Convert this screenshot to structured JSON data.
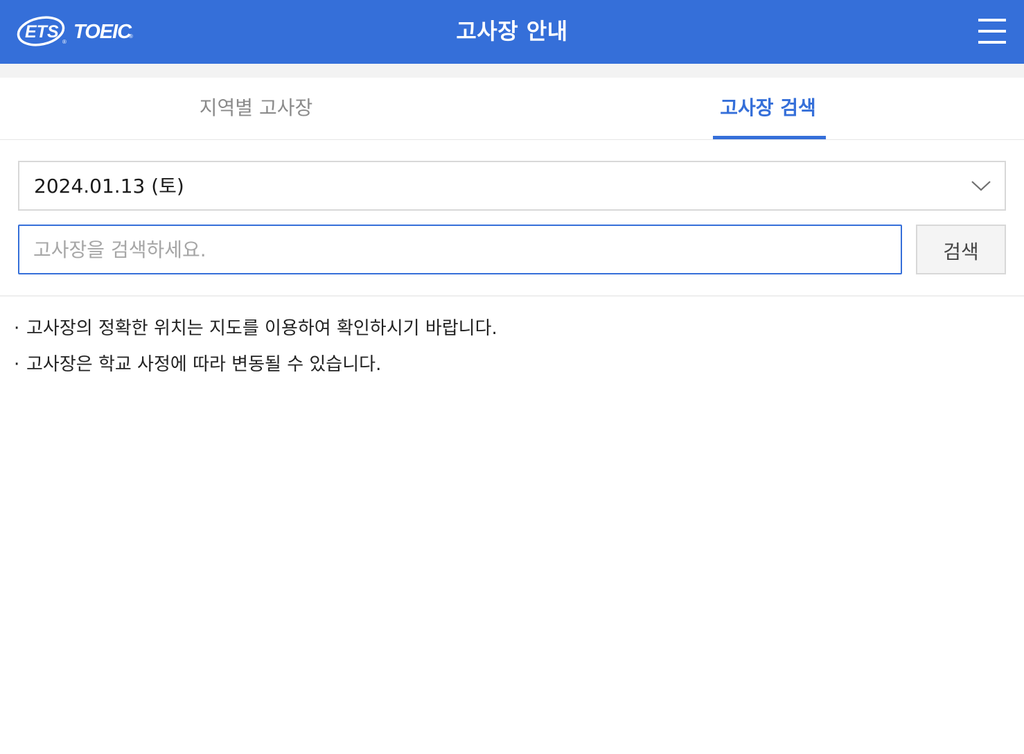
{
  "header": {
    "logo_text": "ETS TOEIC",
    "title": "고사장 안내",
    "menu_icon": "hamburger-menu-icon",
    "background_color": "#356fd9"
  },
  "tabs": [
    {
      "label": "지역별 고사장",
      "active": false
    },
    {
      "label": "고사장 검색",
      "active": true
    }
  ],
  "search": {
    "date_selected": "2024.01.13 (토)",
    "dropdown_icon": "chevron-down-icon",
    "placeholder": "고사장을 검색하세요.",
    "value": "",
    "button_label": "검색"
  },
  "notices": [
    {
      "bullet": "·",
      "text": "고사장의 정확한 위치는 지도를 이용하여 확인하시기 바랍니다."
    },
    {
      "bullet": "·",
      "text": "고사장은 학교 사정에 따라 변동될 수 있습니다."
    }
  ],
  "colors": {
    "accent": "#356fd9",
    "inactive_tab": "#8a8a8a",
    "band": "#f3f3f3"
  }
}
